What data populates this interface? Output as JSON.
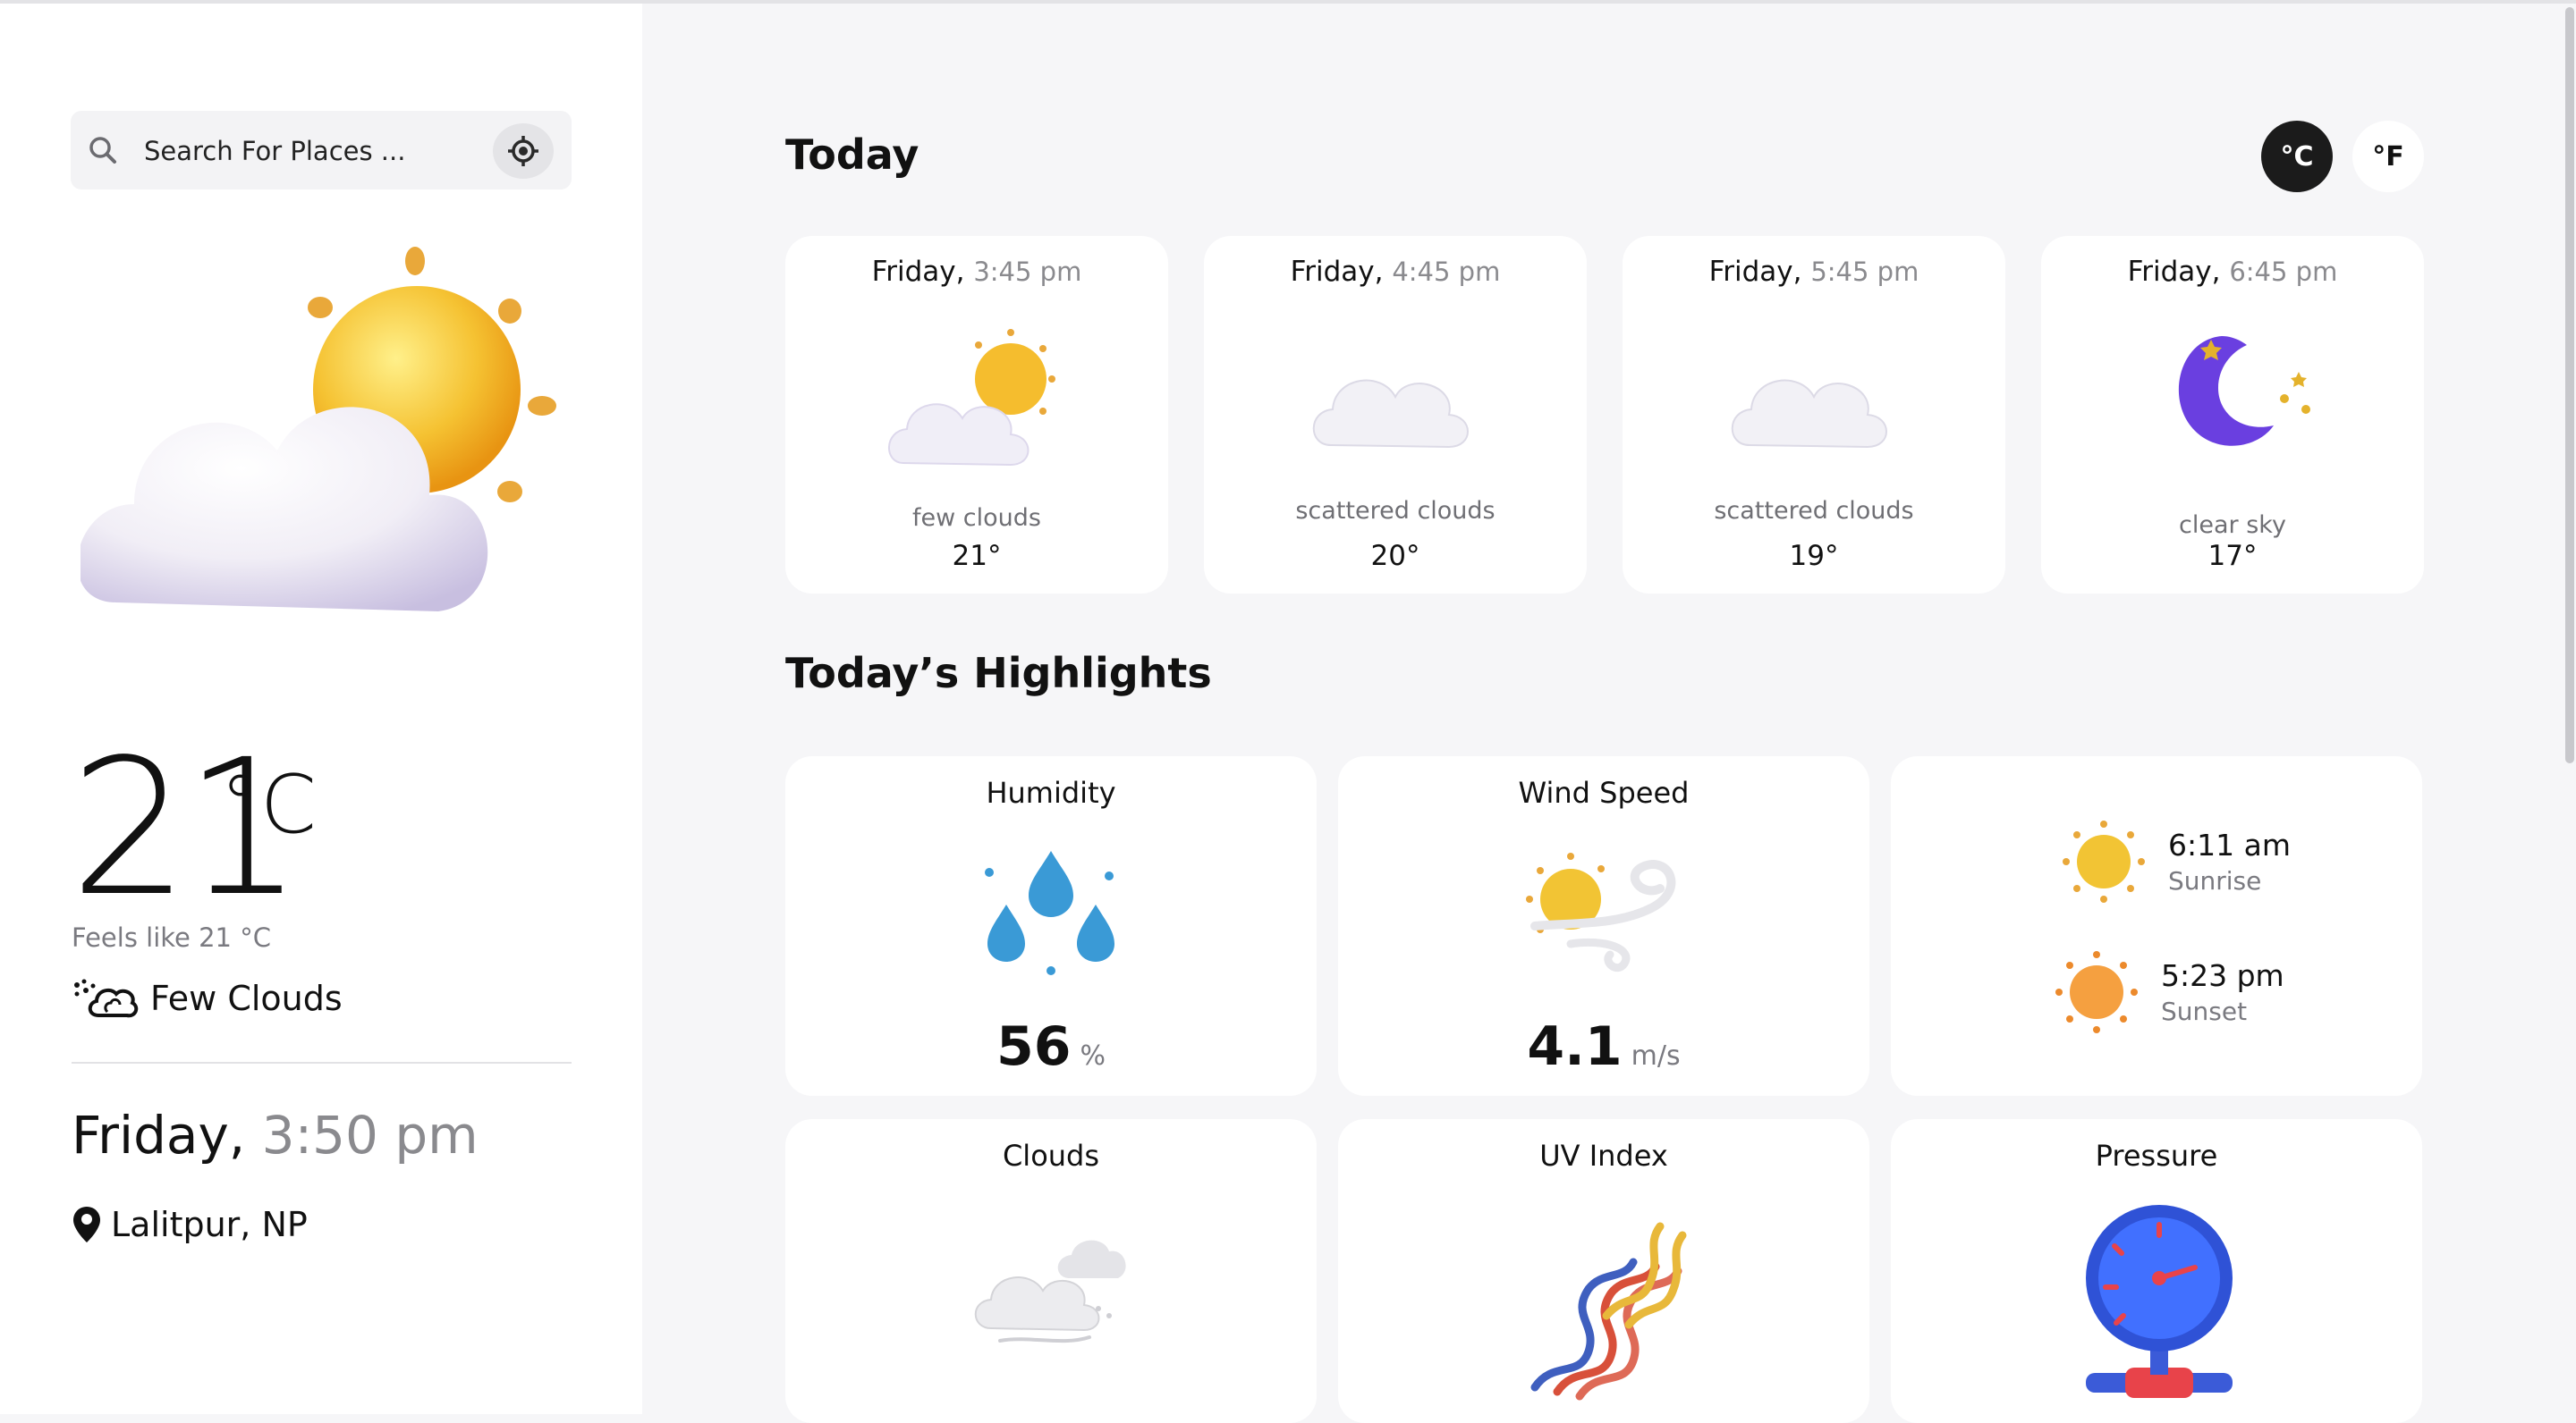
{
  "search": {
    "placeholder": "Search For Places ..."
  },
  "current": {
    "temperature": "21",
    "unit": "°C",
    "feels_like": "Feels like 21 °C",
    "condition": "Few Clouds",
    "day": "Friday,",
    "time": "3:50 pm",
    "location": "Lalitpur, NP",
    "icon": "few-clouds-icon"
  },
  "today": {
    "title": "Today",
    "unit_celsius": "°C",
    "unit_fahrenheit": "°F",
    "active_unit": "celsius",
    "hours": [
      {
        "day": "Friday,",
        "time": "3:45 pm",
        "desc": "few clouds",
        "temp": "21°",
        "icon": "few-clouds-icon"
      },
      {
        "day": "Friday,",
        "time": "4:45 pm",
        "desc": "scattered clouds",
        "temp": "20°",
        "icon": "cloud-icon"
      },
      {
        "day": "Friday,",
        "time": "5:45 pm",
        "desc": "scattered clouds",
        "temp": "19°",
        "icon": "cloud-icon"
      },
      {
        "day": "Friday,",
        "time": "6:45 pm",
        "desc": "clear sky",
        "temp": "17°",
        "icon": "moon-icon"
      }
    ]
  },
  "highlights": {
    "title": "Today’s Highlights",
    "humidity": {
      "label": "Humidity",
      "value": "56",
      "unit": "%"
    },
    "wind": {
      "label": "Wind Speed",
      "value": "4.1",
      "unit": "m/s"
    },
    "sunrise": {
      "time": "6:11 am",
      "label": "Sunrise"
    },
    "sunset": {
      "time": "5:23 pm",
      "label": "Sunset"
    },
    "clouds": {
      "label": "Clouds"
    },
    "uv": {
      "label": "UV Index"
    },
    "pressure": {
      "label": "Pressure"
    }
  },
  "colors": {
    "accent_dark": "#1b1b1b",
    "sun": "#f5b82e",
    "moon": "#6a3fe0",
    "water": "#2f8fd0"
  }
}
